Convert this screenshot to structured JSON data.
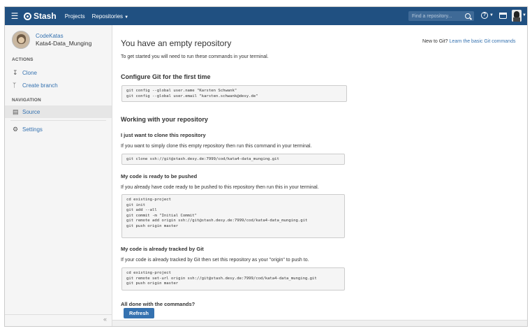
{
  "header": {
    "logo_text": "Stash",
    "nav": [
      "Projects",
      "Repositories"
    ],
    "search_placeholder": "Find a repository...",
    "help_label": "?"
  },
  "sidebar": {
    "project": "CodeKatas",
    "repo": "Kata4-Data_Munging",
    "actions_title": "ACTIONS",
    "actions": [
      {
        "icon": "clone-icon",
        "label": "Clone"
      },
      {
        "icon": "branch-icon",
        "label": "Create branch"
      }
    ],
    "navigation_title": "NAVIGATION",
    "source_label": "Source",
    "settings_label": "Settings",
    "collapse": "«"
  },
  "main": {
    "title": "You have an empty repository",
    "intro": "To get started you will need to run these commands in your terminal.",
    "new_to_git": "New to Git?",
    "learn_link": "Learn the basic Git commands",
    "configure_title": "Configure Git for the first time",
    "configure_code": "git config --global user.name \"Karsten Schwank\"\ngit config --global user.email \"karsten.schwank@desy.de\"",
    "working_title": "Working with your repository",
    "clone_title": "I just want to clone this repository",
    "clone_text": "If you want to simply clone this empty repository then run this command in your terminal.",
    "clone_code": "git clone ssh://git@stash.desy.de:7999/cod/kata4-data_munging.git",
    "push_title": "My code is ready to be pushed",
    "push_text": "If you already have code ready to be pushed to this repository then run this in your terminal.",
    "push_code": "cd existing-project\ngit init\ngit add --all\ngit commit -m \"Initial Commit\"\ngit remote add origin ssh://git@stash.desy.de:7999/cod/kata4-data_munging.git\ngit push origin master",
    "tracked_title": "My code is already tracked by Git",
    "tracked_text": "If your code is already tracked by Git then set this repository as your \"origin\" to push to.",
    "tracked_code": "cd existing-project\ngit remote set-url origin ssh://git@stash.desy.de:7999/cod/kata4-data_munging.git\ngit push origin master",
    "done_title": "All done with the commands?",
    "refresh_label": "Refresh"
  }
}
